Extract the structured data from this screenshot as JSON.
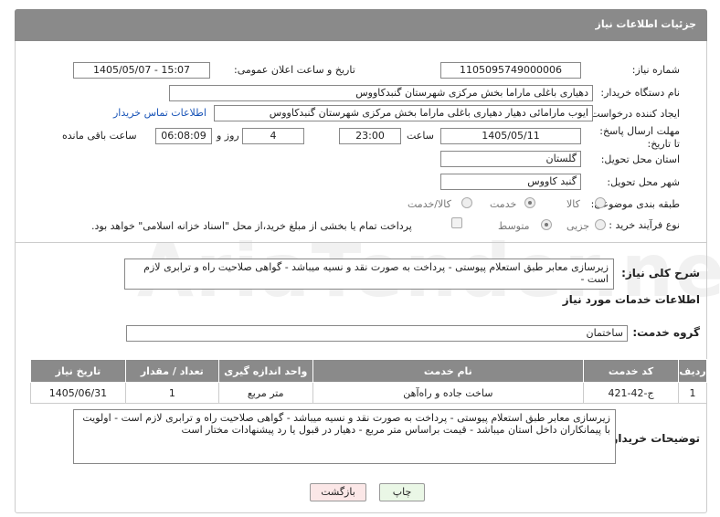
{
  "header": {
    "title": "جزئیات اطلاعات نیاز"
  },
  "form": {
    "need_number_label": "شماره نیاز:",
    "need_number": "1105095749000006",
    "announce_label": "تاریخ و ساعت اعلان عمومی:",
    "announce_value": "1405/05/07 - 15:07",
    "buyer_label": "نام دستگاه خریدار:",
    "buyer_value": "دهیاری باغلی ماراما بخش مرکزی شهرستان گنبدکاووس",
    "creator_label": "ایجاد کننده درخواست:",
    "creator_value": "ایوب مارامائی دهیار دهیاری باغلی ماراما بخش مرکزی شهرستان گنبدکاووس",
    "contact_link": "اطلاعات تماس خریدار",
    "deadline_label": "مهلت ارسال پاسخ: تا تاریخ:",
    "deadline_date": "1405/05/11",
    "time_label": "ساعت",
    "deadline_time": "23:00",
    "days_value": "4",
    "days_label": "روز و",
    "remaining_time": "06:08:09",
    "remaining_label": "ساعت باقی مانده",
    "province_label": "استان محل تحویل:",
    "province_value": "گلستان",
    "city_label": "شهر محل تحویل:",
    "city_value": "گنبد کاووس",
    "category_label": "طبقه بندی موضوعی:",
    "category_options": [
      "کالا",
      "خدمت",
      "کالا/خدمت"
    ],
    "category_selected": "خدمت",
    "purchase_label": "نوع فرآیند خرید :",
    "purchase_options": [
      "جزیی",
      "متوسط"
    ],
    "purchase_selected": "متوسط",
    "payment_note": "پرداخت تمام یا بخشی از مبلغ خرید،از محل \"اسناد خزانه اسلامی\" خواهد بود."
  },
  "summary": {
    "label": "شرح کلی نیاز:",
    "text": "زیرسازی معابر طبق استعلام پیوستی - پرداخت به صورت نقد و نسیه میباشد - گواهی صلاحیت راه و ترابری لازم است -"
  },
  "services": {
    "title": "اطلاعات خدمات مورد نیاز",
    "group_label": "گروه خدمت:",
    "group_value": "ساختمان",
    "columns": [
      "ردیف",
      "کد خدمت",
      "نام خدمت",
      "واحد اندازه گیری",
      "تعداد / مقدار",
      "تاریخ نیاز"
    ],
    "rows": [
      [
        "1",
        "ج-42-421",
        "ساخت جاده و راه‌آهن",
        "متر مربع",
        "1",
        "1405/06/31"
      ]
    ]
  },
  "buyer_notes": {
    "label": "توضیحات خریدار:",
    "text": "زیرسازی معابر طبق استعلام پیوستی - پرداخت به صورت نقد و نسیه میباشد - گواهی صلاحیت راه و ترابری لازم است - اولویت با پیمانکاران داخل استان میباشد - قیمت براساس متر مربع - دهیار در قبول یا رد پیشنهادات مختار است"
  },
  "buttons": {
    "print": "چاپ",
    "back": "بازگشت"
  },
  "colors": {
    "header_bg": "#8a8a8a",
    "link": "#1a55b8",
    "print_bg": "#eaf7e6",
    "back_bg": "#fbe7e7"
  }
}
